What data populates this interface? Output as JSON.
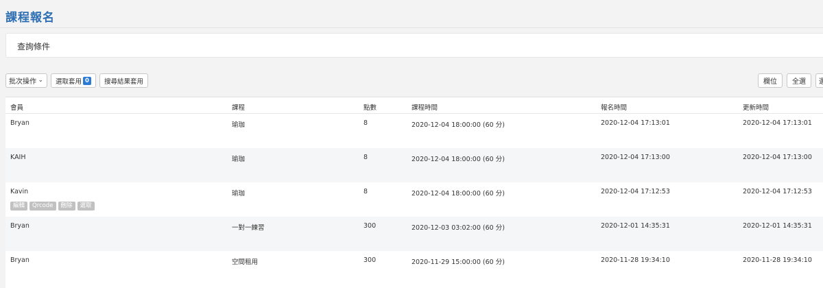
{
  "page": {
    "title": "課程報名"
  },
  "query": {
    "title": "查詢條件"
  },
  "toolbar": {
    "batch_label": "批次操作",
    "apply_selected_label": "選取套用",
    "selected_count": "0",
    "apply_search_label": "搜尋結果套用",
    "columns_label": "欄位",
    "select_all_label": "全選",
    "partial_label": "選"
  },
  "table": {
    "headers": [
      "會員",
      "課程",
      "點數",
      "課程時間",
      "報名時間",
      "更新時間"
    ],
    "rows": [
      {
        "member": "Bryan",
        "course": "瑜珈",
        "points": "8",
        "course_time": "2020-12-04 18:00:00 (60 分)",
        "register_time": "2020-12-04 17:13:01",
        "update_time": "2020-12-04 17:13:01"
      },
      {
        "member": "KAIH",
        "course": "瑜珈",
        "points": "8",
        "course_time": "2020-12-04 18:00:00 (60 分)",
        "register_time": "2020-12-04 17:13:00",
        "update_time": "2020-12-04 17:13:00"
      },
      {
        "member": "Kavin",
        "course": "瑜珈",
        "points": "8",
        "course_time": "2020-12-04 18:00:00 (60 分)",
        "register_time": "2020-12-04 17:12:53",
        "update_time": "2020-12-04 17:12:53"
      },
      {
        "member": "Bryan",
        "course": "一對一練習",
        "points": "300",
        "course_time": "2020-12-03 03:02:00 (60 分)",
        "register_time": "2020-12-01 14:35:31",
        "update_time": "2020-12-01 14:35:31"
      },
      {
        "member": "Bryan",
        "course": "空間租用",
        "points": "300",
        "course_time": "2020-11-29 15:00:00 (60 分)",
        "register_time": "2020-11-28 19:34:10",
        "update_time": "2020-11-28 19:34:10"
      }
    ],
    "row_actions": [
      "編輯",
      "Qrcode",
      "刪除",
      "選取"
    ]
  },
  "colors": {
    "title": "#2f6fb3",
    "badge": "#2a7ad6",
    "action_bg": "#c1c1c1"
  }
}
